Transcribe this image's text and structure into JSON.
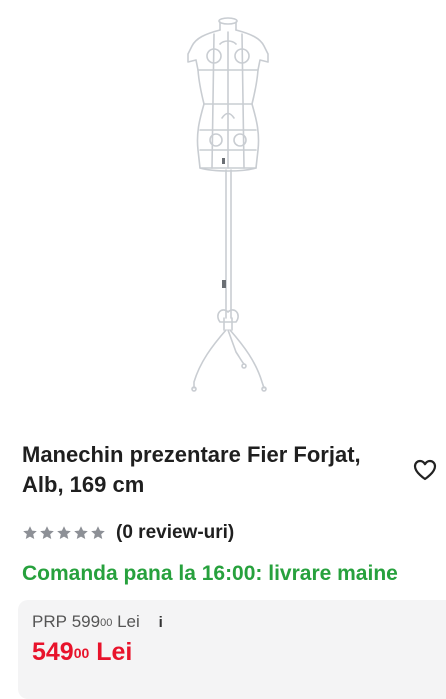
{
  "product": {
    "title": "Manechin prezentare Fier Forjat, Alb, 169 cm",
    "image_alt": "Manechin prezentare fier forjat alb"
  },
  "rating": {
    "stars_filled": 0,
    "stars_total": 5,
    "review_text": "(0 review-uri)"
  },
  "delivery": {
    "text": "Comanda pana la 16:00: livrare maine",
    "color": "#27a13d"
  },
  "pricing": {
    "prp_label": "PRP",
    "prp_integer": "599",
    "prp_decimals": "00",
    "prp_currency": "Lei",
    "price_integer": "549",
    "price_decimals": "00",
    "price_currency": "Lei",
    "price_color": "#e8132b",
    "info_icon": "i"
  },
  "icons": {
    "wishlist": "heart-outline-icon",
    "info": "info-icon",
    "star": "star-icon"
  }
}
